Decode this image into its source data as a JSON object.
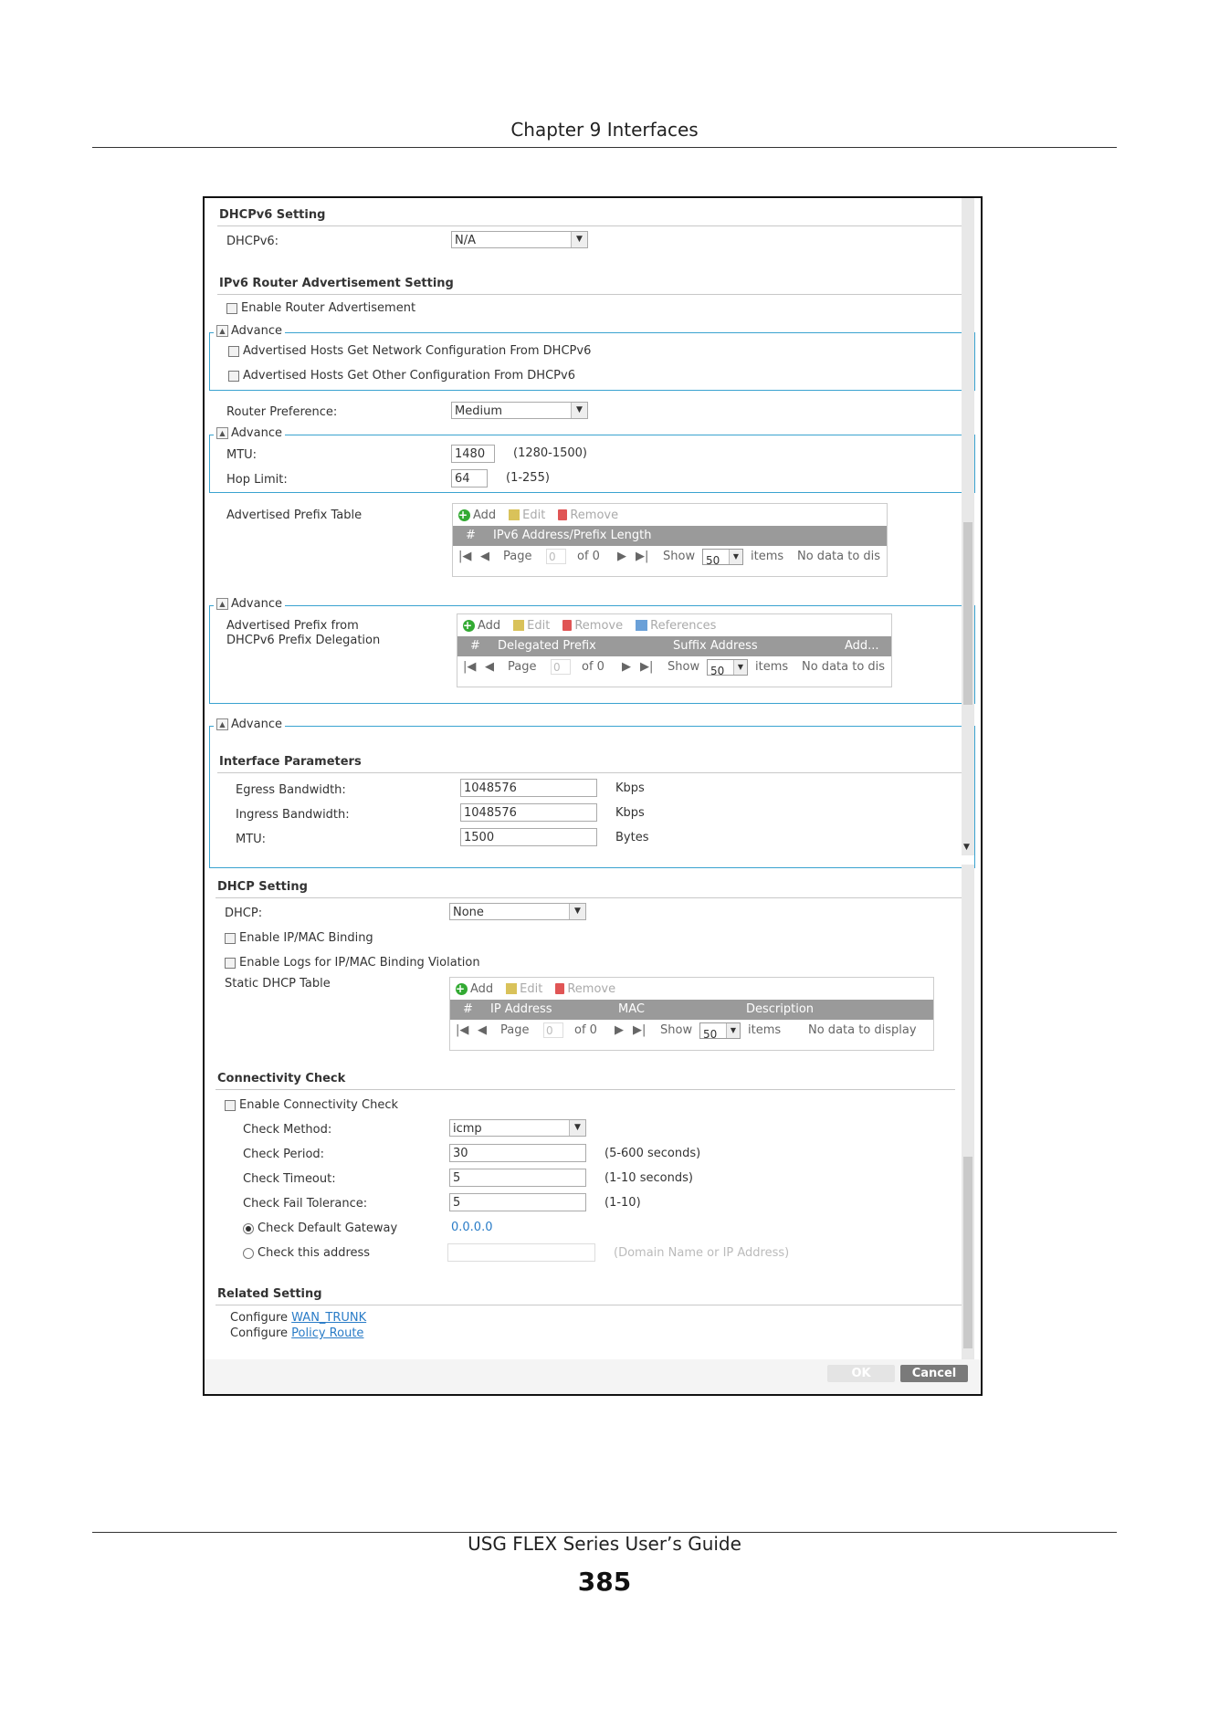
{
  "page": {
    "chapter": "Chapter 9 Interfaces",
    "guide": "USG FLEX Series User’s Guide",
    "page_number": "385"
  },
  "dhcpv6": {
    "section": "DHCPv6 Setting",
    "label": "DHCPv6:",
    "value": "N/A"
  },
  "ra": {
    "section": "IPv6 Router Advertisement Setting",
    "enable": "Enable Router Advertisement",
    "advance": "Advance",
    "adv_net": "Advertised Hosts Get Network Configuration From DHCPv6",
    "adv_other": "Advertised Hosts Get Other Configuration From DHCPv6",
    "pref_label": "Router Preference:",
    "pref_value": "Medium",
    "advance2": "Advance",
    "mtu_label": "MTU:",
    "mtu_value": "1480",
    "mtu_range": "(1280-1500)",
    "hop_label": "Hop Limit:",
    "hop_value": "64",
    "hop_range": "(1-255)"
  },
  "prefix_table": {
    "label": "Advertised Prefix Table",
    "add": "Add",
    "edit": "Edit",
    "remove": "Remove",
    "col_num": "#",
    "col_addr": "IPv6 Address/Prefix Length",
    "page": "Page",
    "page_value": "0",
    "of": "of 0",
    "show": "Show",
    "show_value": "50",
    "items": "items",
    "nodata": "No data to dis"
  },
  "delegation": {
    "advance": "Advance",
    "label1": "Advertised Prefix from",
    "label2": "DHCPv6 Prefix Delegation",
    "add": "Add",
    "edit": "Edit",
    "remove": "Remove",
    "references": "References",
    "col_num": "#",
    "col_prefix": "Delegated Prefix",
    "col_suffix": "Suffix Address",
    "col_add": "Add...",
    "page": "Page",
    "page_value": "0",
    "of": "of 0",
    "show": "Show",
    "show_value": "50",
    "items": "items",
    "nodata": "No data to dis"
  },
  "iface": {
    "advance": "Advance",
    "section": "Interface Parameters",
    "egress_label": "Egress Bandwidth:",
    "egress_value": "1048576",
    "egress_unit": "Kbps",
    "ingress_label": "Ingress Bandwidth:",
    "ingress_value": "1048576",
    "ingress_unit": "Kbps",
    "mtu_label": "MTU:",
    "mtu_value": "1500",
    "mtu_unit": "Bytes"
  },
  "dhcp": {
    "section": "DHCP Setting",
    "label": "DHCP:",
    "value": "None",
    "binding": "Enable IP/MAC Binding",
    "logs": "Enable Logs for IP/MAC Binding Violation",
    "static_label": "Static DHCP Table",
    "add": "Add",
    "edit": "Edit",
    "remove": "Remove",
    "col_num": "#",
    "col_ip": "IP Address",
    "col_mac": "MAC",
    "col_desc": "Description",
    "page": "Page",
    "page_value": "0",
    "of": "of 0",
    "show": "Show",
    "show_value": "50",
    "items": "items",
    "nodata": "No data to display"
  },
  "conn": {
    "section": "Connectivity Check",
    "enable": "Enable Connectivity Check",
    "method_label": "Check Method:",
    "method_value": "icmp",
    "period_label": "Check Period:",
    "period_value": "30",
    "period_range": "(5-600 seconds)",
    "timeout_label": "Check Timeout:",
    "timeout_value": "5",
    "timeout_range": "(1-10 seconds)",
    "fail_label": "Check Fail Tolerance:",
    "fail_value": "5",
    "fail_range": "(1-10)",
    "gw_label": "Check Default Gateway",
    "gw_value": "0.0.0.0",
    "addr_label": "Check this address",
    "addr_hint": "(Domain Name or IP Address)"
  },
  "related": {
    "section": "Related Setting",
    "configure": "Configure",
    "wan": "WAN_TRUNK",
    "policy": "Policy Route"
  },
  "buttons": {
    "ok": "OK",
    "cancel": "Cancel"
  },
  "colors": {
    "frame_border": "#3aa3d0",
    "link": "#2a7cc7",
    "header_gray": "#9a9a9a",
    "cancel_bg": "#7a7a7a"
  }
}
